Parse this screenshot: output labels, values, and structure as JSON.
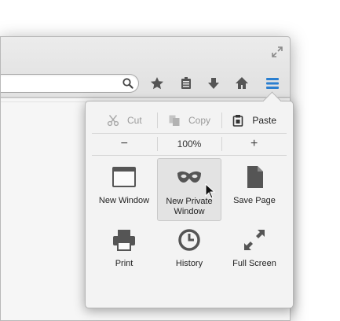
{
  "edit": [
    {
      "label": "Cut",
      "icon": "scissors-icon",
      "enabled": false
    },
    {
      "label": "Copy",
      "icon": "copy-icon",
      "enabled": false
    },
    {
      "label": "Paste",
      "icon": "paste-icon",
      "enabled": true
    }
  ],
  "zoom": {
    "decrease": "−",
    "level": "100%",
    "increase": "+"
  },
  "items": [
    {
      "label": "New Window",
      "icon": "new-window-icon"
    },
    {
      "label": "New Private Window",
      "icon": "private-mask-icon",
      "hovered": true
    },
    {
      "label": "Save Page",
      "icon": "save-page-icon"
    },
    {
      "label": "Print",
      "icon": "printer-icon"
    },
    {
      "label": "History",
      "icon": "clock-icon"
    },
    {
      "label": "Full Screen",
      "icon": "expand-arrows-icon"
    }
  ],
  "toolbar": {
    "menu_accent": "#2b7fd0"
  }
}
